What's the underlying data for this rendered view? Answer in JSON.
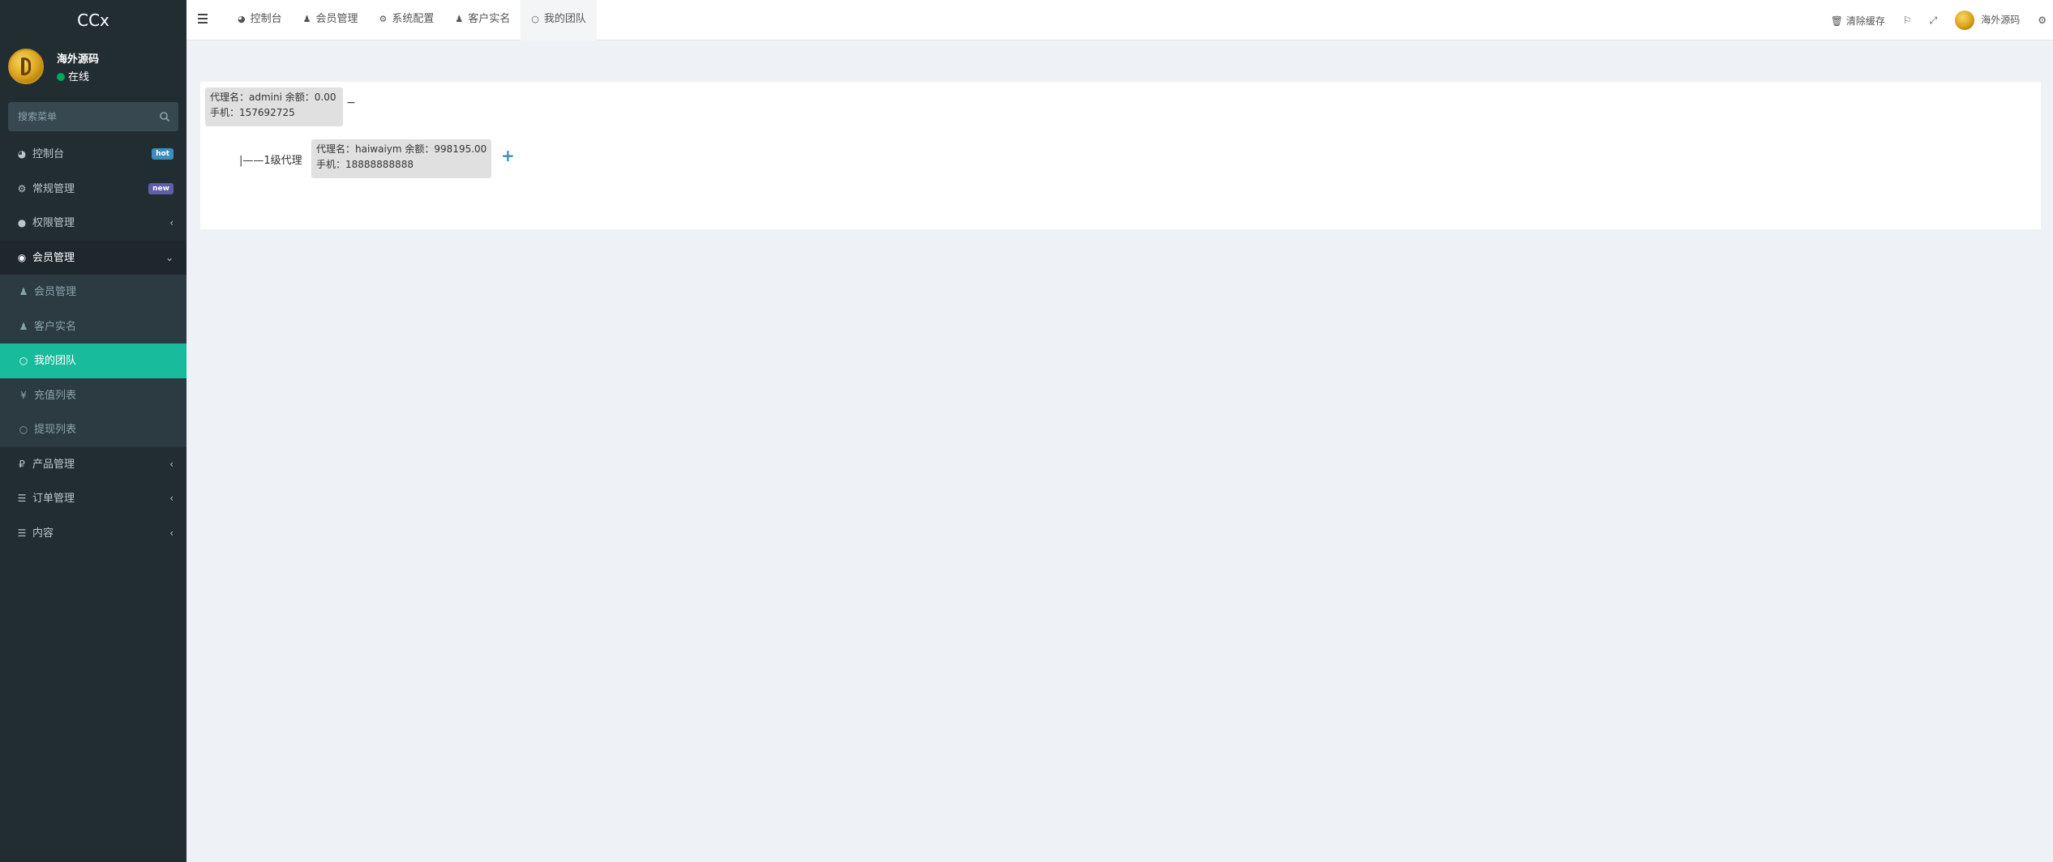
{
  "app": {
    "title": "CCx"
  },
  "user": {
    "name": "海外源码",
    "status": "在线"
  },
  "search": {
    "placeholder": "搜索菜单"
  },
  "sidebar": {
    "items": [
      {
        "label": "控制台",
        "icon": "dashboard-icon",
        "badge": "hot"
      },
      {
        "label": "常规管理",
        "icon": "cogs-icon",
        "badge": "new"
      },
      {
        "label": "权限管理",
        "icon": "group-icon"
      },
      {
        "label": "会员管理",
        "icon": "user-circle-icon",
        "expanded": true
      },
      {
        "label": "会员管理",
        "icon": "user-icon"
      },
      {
        "label": "客户实名",
        "icon": "user-icon"
      },
      {
        "label": "我的团队",
        "icon": "circle-icon",
        "active": true
      },
      {
        "label": "充值列表",
        "icon": "yen-icon"
      },
      {
        "label": "提现列表",
        "icon": "circle-icon"
      },
      {
        "label": "产品管理",
        "icon": "ruble-icon"
      },
      {
        "label": "订单管理",
        "icon": "list-icon"
      },
      {
        "label": "内容",
        "icon": "list-icon"
      }
    ]
  },
  "navbar": {
    "tabs": [
      {
        "label": "控制台",
        "icon": "dashboard-icon"
      },
      {
        "label": "会员管理",
        "icon": "user-icon"
      },
      {
        "label": "系统配置",
        "icon": "gear-icon"
      },
      {
        "label": "客户实名",
        "icon": "user-icon"
      },
      {
        "label": "我的团队",
        "icon": "circle-icon",
        "active": true
      }
    ],
    "clear_cache": "清除缓存",
    "user_name": "海外源码"
  },
  "team": {
    "root": {
      "line1": "代理名：admini 余额：0.00",
      "line2": "手机：157692725",
      "toggle": "−"
    },
    "level_label": "|——1级代理",
    "child": {
      "line1": "代理名：haiwaiym 余额：998195.00",
      "line2": "手机：18888888888",
      "toggle": "+"
    }
  },
  "colors": {
    "sidebar_bg": "#222d32",
    "active": "#18bc9c",
    "content_bg": "#eef1f5"
  }
}
